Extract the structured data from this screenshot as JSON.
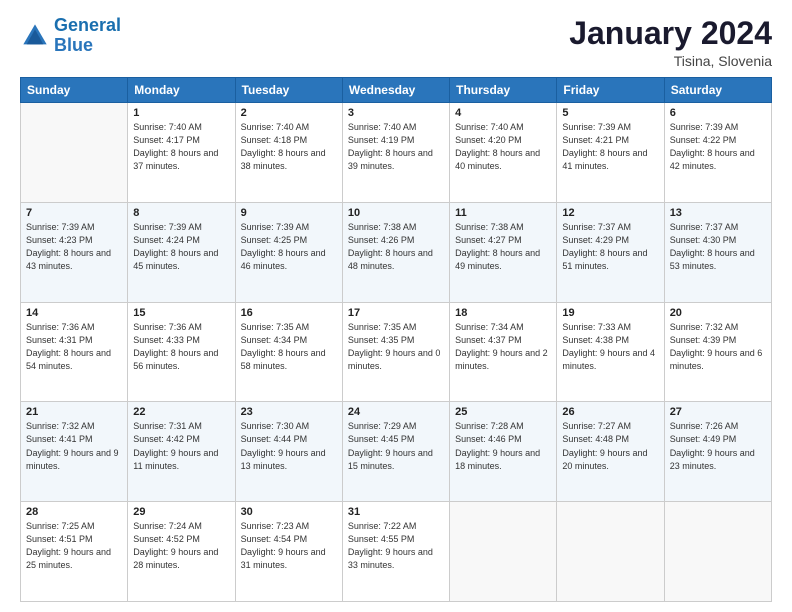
{
  "header": {
    "logo_line1": "General",
    "logo_line2": "Blue",
    "month_year": "January 2024",
    "location": "Tisina, Slovenia"
  },
  "weekdays": [
    "Sunday",
    "Monday",
    "Tuesday",
    "Wednesday",
    "Thursday",
    "Friday",
    "Saturday"
  ],
  "weeks": [
    [
      {
        "day": "",
        "sunrise": "",
        "sunset": "",
        "daylight": ""
      },
      {
        "day": "1",
        "sunrise": "Sunrise: 7:40 AM",
        "sunset": "Sunset: 4:17 PM",
        "daylight": "Daylight: 8 hours and 37 minutes."
      },
      {
        "day": "2",
        "sunrise": "Sunrise: 7:40 AM",
        "sunset": "Sunset: 4:18 PM",
        "daylight": "Daylight: 8 hours and 38 minutes."
      },
      {
        "day": "3",
        "sunrise": "Sunrise: 7:40 AM",
        "sunset": "Sunset: 4:19 PM",
        "daylight": "Daylight: 8 hours and 39 minutes."
      },
      {
        "day": "4",
        "sunrise": "Sunrise: 7:40 AM",
        "sunset": "Sunset: 4:20 PM",
        "daylight": "Daylight: 8 hours and 40 minutes."
      },
      {
        "day": "5",
        "sunrise": "Sunrise: 7:39 AM",
        "sunset": "Sunset: 4:21 PM",
        "daylight": "Daylight: 8 hours and 41 minutes."
      },
      {
        "day": "6",
        "sunrise": "Sunrise: 7:39 AM",
        "sunset": "Sunset: 4:22 PM",
        "daylight": "Daylight: 8 hours and 42 minutes."
      }
    ],
    [
      {
        "day": "7",
        "sunrise": "Sunrise: 7:39 AM",
        "sunset": "Sunset: 4:23 PM",
        "daylight": "Daylight: 8 hours and 43 minutes."
      },
      {
        "day": "8",
        "sunrise": "Sunrise: 7:39 AM",
        "sunset": "Sunset: 4:24 PM",
        "daylight": "Daylight: 8 hours and 45 minutes."
      },
      {
        "day": "9",
        "sunrise": "Sunrise: 7:39 AM",
        "sunset": "Sunset: 4:25 PM",
        "daylight": "Daylight: 8 hours and 46 minutes."
      },
      {
        "day": "10",
        "sunrise": "Sunrise: 7:38 AM",
        "sunset": "Sunset: 4:26 PM",
        "daylight": "Daylight: 8 hours and 48 minutes."
      },
      {
        "day": "11",
        "sunrise": "Sunrise: 7:38 AM",
        "sunset": "Sunset: 4:27 PM",
        "daylight": "Daylight: 8 hours and 49 minutes."
      },
      {
        "day": "12",
        "sunrise": "Sunrise: 7:37 AM",
        "sunset": "Sunset: 4:29 PM",
        "daylight": "Daylight: 8 hours and 51 minutes."
      },
      {
        "day": "13",
        "sunrise": "Sunrise: 7:37 AM",
        "sunset": "Sunset: 4:30 PM",
        "daylight": "Daylight: 8 hours and 53 minutes."
      }
    ],
    [
      {
        "day": "14",
        "sunrise": "Sunrise: 7:36 AM",
        "sunset": "Sunset: 4:31 PM",
        "daylight": "Daylight: 8 hours and 54 minutes."
      },
      {
        "day": "15",
        "sunrise": "Sunrise: 7:36 AM",
        "sunset": "Sunset: 4:33 PM",
        "daylight": "Daylight: 8 hours and 56 minutes."
      },
      {
        "day": "16",
        "sunrise": "Sunrise: 7:35 AM",
        "sunset": "Sunset: 4:34 PM",
        "daylight": "Daylight: 8 hours and 58 minutes."
      },
      {
        "day": "17",
        "sunrise": "Sunrise: 7:35 AM",
        "sunset": "Sunset: 4:35 PM",
        "daylight": "Daylight: 9 hours and 0 minutes."
      },
      {
        "day": "18",
        "sunrise": "Sunrise: 7:34 AM",
        "sunset": "Sunset: 4:37 PM",
        "daylight": "Daylight: 9 hours and 2 minutes."
      },
      {
        "day": "19",
        "sunrise": "Sunrise: 7:33 AM",
        "sunset": "Sunset: 4:38 PM",
        "daylight": "Daylight: 9 hours and 4 minutes."
      },
      {
        "day": "20",
        "sunrise": "Sunrise: 7:32 AM",
        "sunset": "Sunset: 4:39 PM",
        "daylight": "Daylight: 9 hours and 6 minutes."
      }
    ],
    [
      {
        "day": "21",
        "sunrise": "Sunrise: 7:32 AM",
        "sunset": "Sunset: 4:41 PM",
        "daylight": "Daylight: 9 hours and 9 minutes."
      },
      {
        "day": "22",
        "sunrise": "Sunrise: 7:31 AM",
        "sunset": "Sunset: 4:42 PM",
        "daylight": "Daylight: 9 hours and 11 minutes."
      },
      {
        "day": "23",
        "sunrise": "Sunrise: 7:30 AM",
        "sunset": "Sunset: 4:44 PM",
        "daylight": "Daylight: 9 hours and 13 minutes."
      },
      {
        "day": "24",
        "sunrise": "Sunrise: 7:29 AM",
        "sunset": "Sunset: 4:45 PM",
        "daylight": "Daylight: 9 hours and 15 minutes."
      },
      {
        "day": "25",
        "sunrise": "Sunrise: 7:28 AM",
        "sunset": "Sunset: 4:46 PM",
        "daylight": "Daylight: 9 hours and 18 minutes."
      },
      {
        "day": "26",
        "sunrise": "Sunrise: 7:27 AM",
        "sunset": "Sunset: 4:48 PM",
        "daylight": "Daylight: 9 hours and 20 minutes."
      },
      {
        "day": "27",
        "sunrise": "Sunrise: 7:26 AM",
        "sunset": "Sunset: 4:49 PM",
        "daylight": "Daylight: 9 hours and 23 minutes."
      }
    ],
    [
      {
        "day": "28",
        "sunrise": "Sunrise: 7:25 AM",
        "sunset": "Sunset: 4:51 PM",
        "daylight": "Daylight: 9 hours and 25 minutes."
      },
      {
        "day": "29",
        "sunrise": "Sunrise: 7:24 AM",
        "sunset": "Sunset: 4:52 PM",
        "daylight": "Daylight: 9 hours and 28 minutes."
      },
      {
        "day": "30",
        "sunrise": "Sunrise: 7:23 AM",
        "sunset": "Sunset: 4:54 PM",
        "daylight": "Daylight: 9 hours and 31 minutes."
      },
      {
        "day": "31",
        "sunrise": "Sunrise: 7:22 AM",
        "sunset": "Sunset: 4:55 PM",
        "daylight": "Daylight: 9 hours and 33 minutes."
      },
      {
        "day": "",
        "sunrise": "",
        "sunset": "",
        "daylight": ""
      },
      {
        "day": "",
        "sunrise": "",
        "sunset": "",
        "daylight": ""
      },
      {
        "day": "",
        "sunrise": "",
        "sunset": "",
        "daylight": ""
      }
    ]
  ]
}
